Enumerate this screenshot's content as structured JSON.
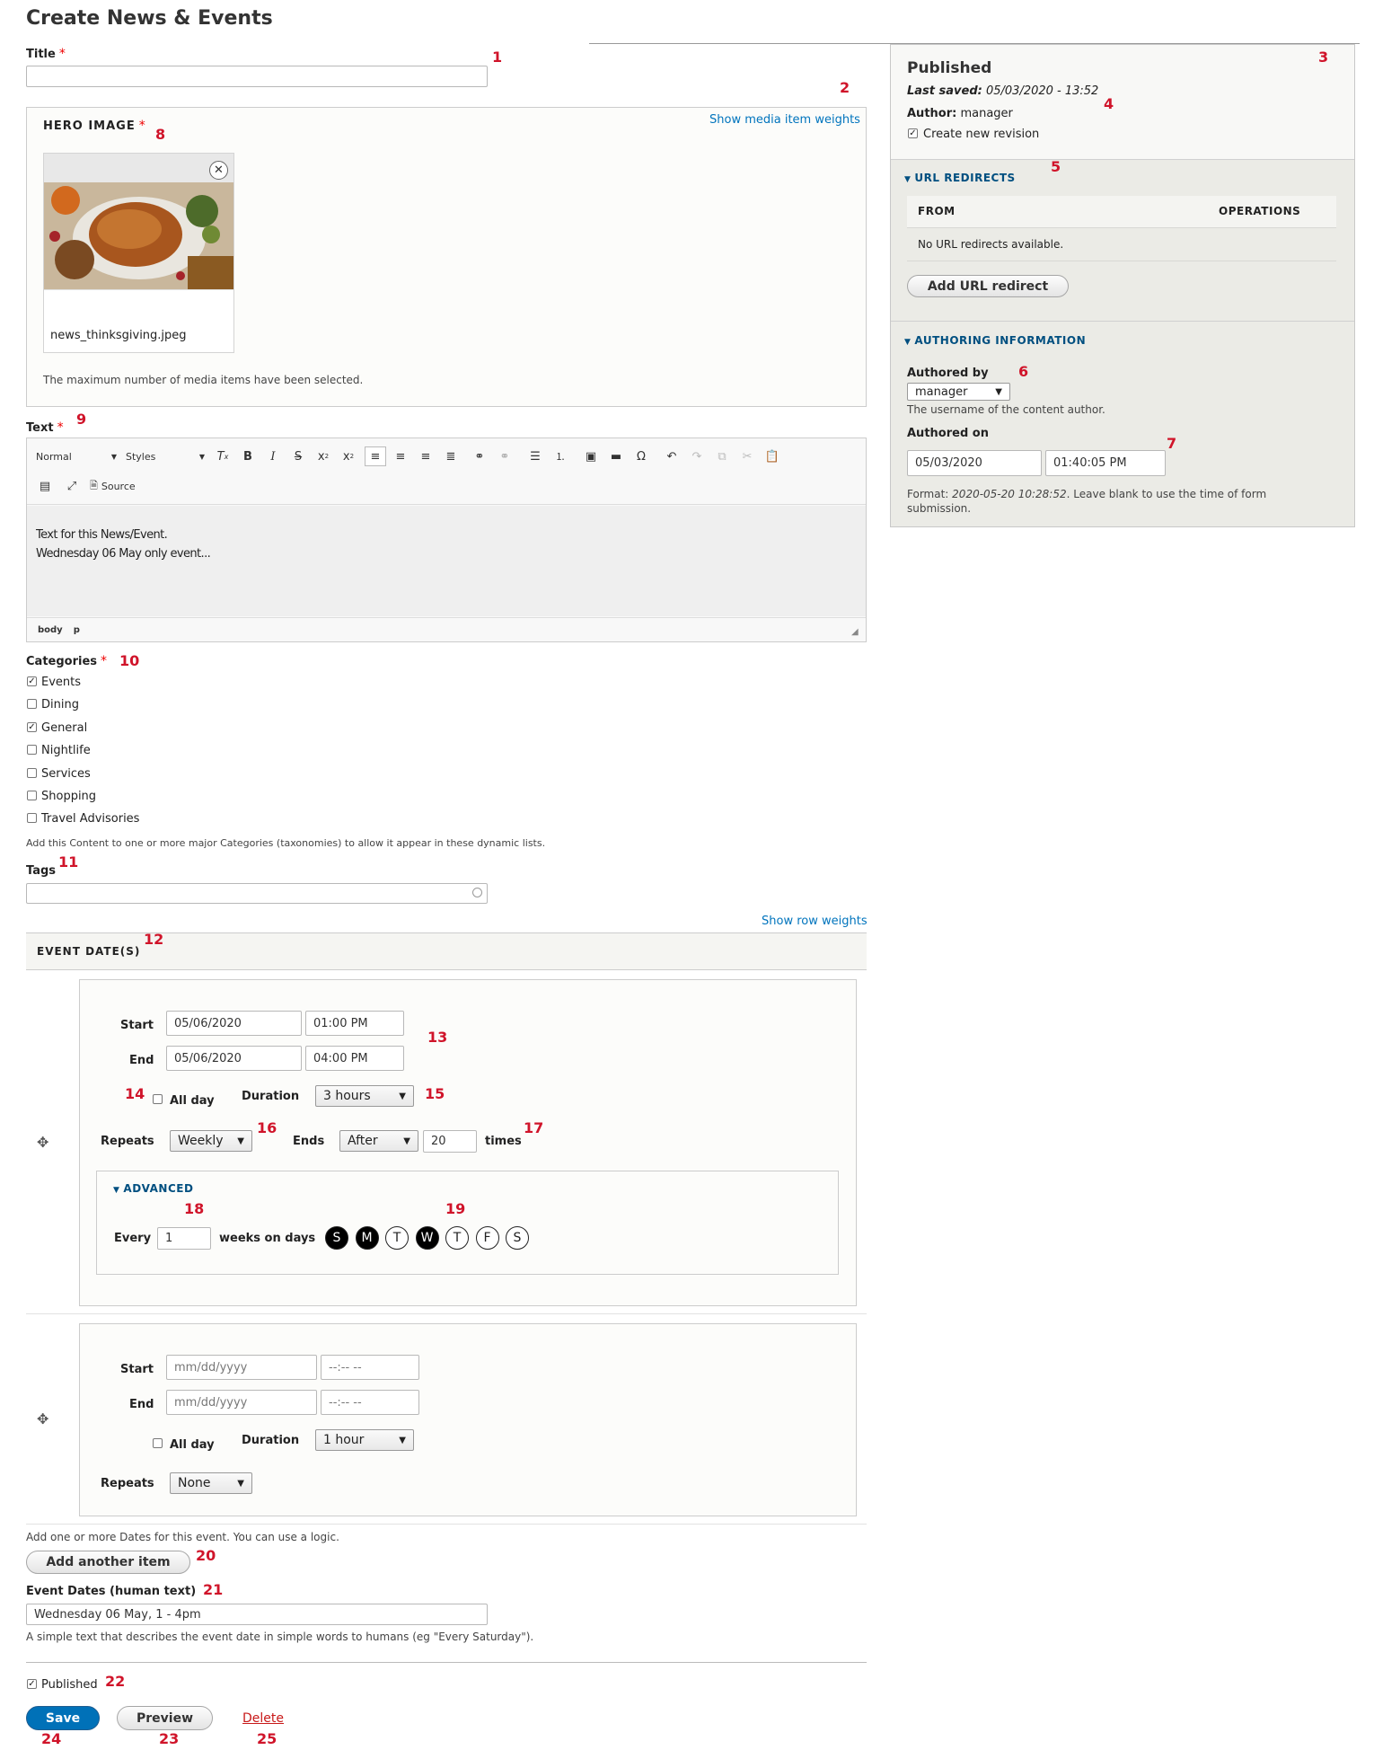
{
  "page_title": "Create News & Events",
  "title_field": {
    "label": "Title",
    "required": "*",
    "value": ""
  },
  "hero": {
    "label": "HERO IMAGE",
    "required": "*",
    "weights_link": "Show media item weights",
    "filename": "news_thinksgiving.jpeg",
    "max_note": "The maximum number of media items have been selected.",
    "remove_icon": "close-icon"
  },
  "text_field": {
    "label": "Text",
    "required": "*",
    "format_select": "Normal",
    "styles_select": "Styles",
    "source_label": "Source",
    "body_lines": [
      "Text for this News/Event.",
      "Wednesday 06 May only event..."
    ],
    "path": [
      "body",
      "p"
    ]
  },
  "categories": {
    "label": "Categories",
    "required": "*",
    "items": [
      {
        "label": "Events",
        "checked": true
      },
      {
        "label": "Dining",
        "checked": false
      },
      {
        "label": "General",
        "checked": true
      },
      {
        "label": "Nightlife",
        "checked": false
      },
      {
        "label": "Services",
        "checked": false
      },
      {
        "label": "Shopping",
        "checked": false
      },
      {
        "label": "Travel Advisories",
        "checked": false
      }
    ],
    "help": "Add this Content to one or more major Categories (taxonomies) to allow it appear in these dynamic lists."
  },
  "tags": {
    "label": "Tags",
    "value": ""
  },
  "event_dates": {
    "weights_link": "Show row weights",
    "header": "EVENT DATE(S)",
    "item1": {
      "start_label": "Start",
      "start_date": "05/06/2020",
      "start_time": "01:00 PM",
      "end_label": "End",
      "end_date": "05/06/2020",
      "end_time": "04:00 PM",
      "allday_label": "All day",
      "duration_label": "Duration",
      "duration": "3 hours",
      "repeats_label": "Repeats",
      "repeats": "Weekly",
      "ends_label": "Ends",
      "ends": "After",
      "ends_count": "20",
      "times_label": "times",
      "advanced_label": "ADVANCED",
      "every_label": "Every",
      "every_value": "1",
      "weeks_label": "weeks on days",
      "days": [
        {
          "letter": "S",
          "on": true
        },
        {
          "letter": "M",
          "on": true
        },
        {
          "letter": "T",
          "on": false
        },
        {
          "letter": "W",
          "on": true
        },
        {
          "letter": "T",
          "on": false
        },
        {
          "letter": "F",
          "on": false
        },
        {
          "letter": "S",
          "on": false
        }
      ]
    },
    "item2": {
      "start_label": "Start",
      "date_placeholder": "mm/dd/yyyy",
      "time_placeholder": "--:-- --",
      "end_label": "End",
      "allday_label": "All day",
      "duration_label": "Duration",
      "duration": "1 hour",
      "repeats_label": "Repeats",
      "repeats": "None"
    },
    "help": "Add one or more Dates for this event. You can use a logic.",
    "add_button": "Add another item"
  },
  "human_text": {
    "label": "Event Dates (human text)",
    "value": "Wednesday 06 May, 1 - 4pm",
    "help": "A simple text that describes the event date in simple words to humans (eg \"Every Saturday\")."
  },
  "footer": {
    "published_label": "Published",
    "published_checked": true,
    "save": "Save",
    "preview": "Preview",
    "delete": "Delete"
  },
  "sidebar": {
    "status": "Published",
    "last_saved_label": "Last saved:",
    "last_saved_value": "05/03/2020 - 13:52",
    "author_label": "Author:",
    "author_value": "manager",
    "revision_label": "Create new revision",
    "url_redirects": {
      "title": "URL REDIRECTS",
      "col_from": "FROM",
      "col_ops": "OPERATIONS",
      "empty": "No URL redirects available.",
      "add_button": "Add URL redirect"
    },
    "authoring": {
      "title": "AUTHORING INFORMATION",
      "authored_by_label": "Authored by",
      "authored_by_value": "manager",
      "authored_by_help": "The username of the content author.",
      "authored_on_label": "Authored on",
      "date": "05/03/2020",
      "time": "01:40:05 PM",
      "format_prefix": "Format:",
      "format_example": "2020-05-20 10:28:52",
      "format_suffix": ". Leave blank to use the time of form",
      "format_line2": "submission."
    }
  },
  "annotations": [
    "1",
    "2",
    "3",
    "4",
    "5",
    "6",
    "7",
    "8",
    "9",
    "10",
    "11",
    "12",
    "13",
    "14",
    "15",
    "16",
    "17",
    "18",
    "19",
    "20",
    "21",
    "22",
    "23",
    "24",
    "25"
  ],
  "colors": {
    "link": "#0074bd",
    "annotation": "#d0142a",
    "primary_button": "#0071b8",
    "sidebar_bg": "#ebebe6"
  }
}
